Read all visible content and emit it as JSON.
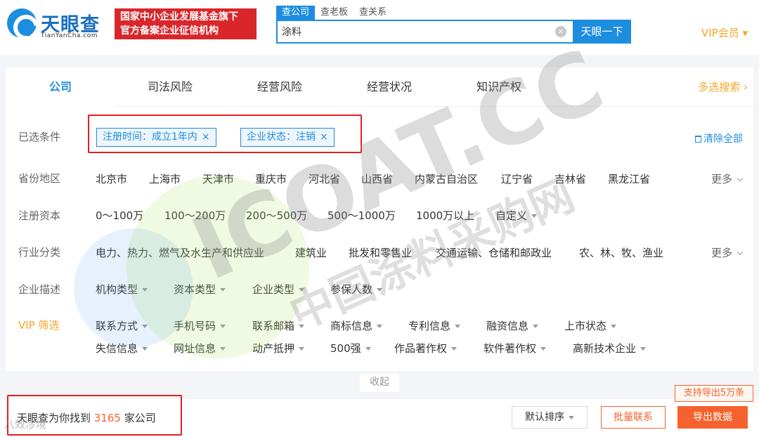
{
  "header": {
    "logo_name": "天眼查",
    "logo_sub": "TianYanCha.com",
    "badge_line1": "国家中小企业发展基金旗下",
    "badge_line2": "官方备案企业征信机构",
    "search_tabs": [
      "查公司",
      "查老板",
      "查关系"
    ],
    "search_value": "涂料",
    "clear_icon": "×",
    "search_button": "天眼一下",
    "vip_label": "VIP会员 ▾"
  },
  "tabs": [
    "公司",
    "司法风险",
    "经营风险",
    "经营状况",
    "知识产权"
  ],
  "multi_search": "多选搜索 ›",
  "selected": {
    "label": "已选条件",
    "tags": [
      "注册时间：成立1年内",
      "企业状态：注销"
    ],
    "tag_close": "×",
    "clear_all": "清除全部"
  },
  "province": {
    "label": "省份地区",
    "options": [
      "北京市",
      "上海市",
      "天津市",
      "重庆市",
      "河北省",
      "山西省",
      "内蒙古自治区",
      "辽宁省",
      "吉林省",
      "黑龙江省"
    ],
    "more": "更多"
  },
  "capital": {
    "label": "注册资本",
    "options": [
      "0～100万",
      "100～200万",
      "200～500万",
      "500～1000万",
      "1000万以上"
    ],
    "custom": "自定义"
  },
  "industry": {
    "label": "行业分类",
    "options": [
      "电力、热力、燃气及水生产和供应业",
      "建筑业",
      "批发和零售业",
      "交通运输、仓储和邮政业",
      "农、林、牧、渔业"
    ],
    "more": "更多"
  },
  "describe": {
    "label": "企业描述",
    "options": [
      "机构类型",
      "资本类型",
      "企业类型",
      "参保人数"
    ]
  },
  "vip_filter": {
    "label": "VIP 筛选",
    "row1": [
      "联系方式",
      "手机号码",
      "联系邮箱",
      "商标信息",
      "专利信息",
      "融资信息",
      "上市状态"
    ],
    "row2": [
      "失信信息",
      "网址信息",
      "动产抵押",
      "500强",
      "作品著作权",
      "软件著作权",
      "高新技术企业"
    ]
  },
  "collapse": "收起",
  "result": {
    "prefix": "天眼查为你找到 ",
    "count": "3165",
    "suffix": " 家公司"
  },
  "sort_button": "默认排序",
  "batch_button": "批量联系",
  "export_button": "导出数据",
  "export_tip": "支持导出5万条",
  "watermark": {
    "main": "ICOAT.CC",
    "sub": "中国涂料采购网",
    "corner": "八效涉境"
  },
  "colors": {
    "brand_blue": "#1d8de0",
    "orange": "#f5622d",
    "vip_gold": "#f5a623",
    "highlight_red": "#e02020"
  }
}
